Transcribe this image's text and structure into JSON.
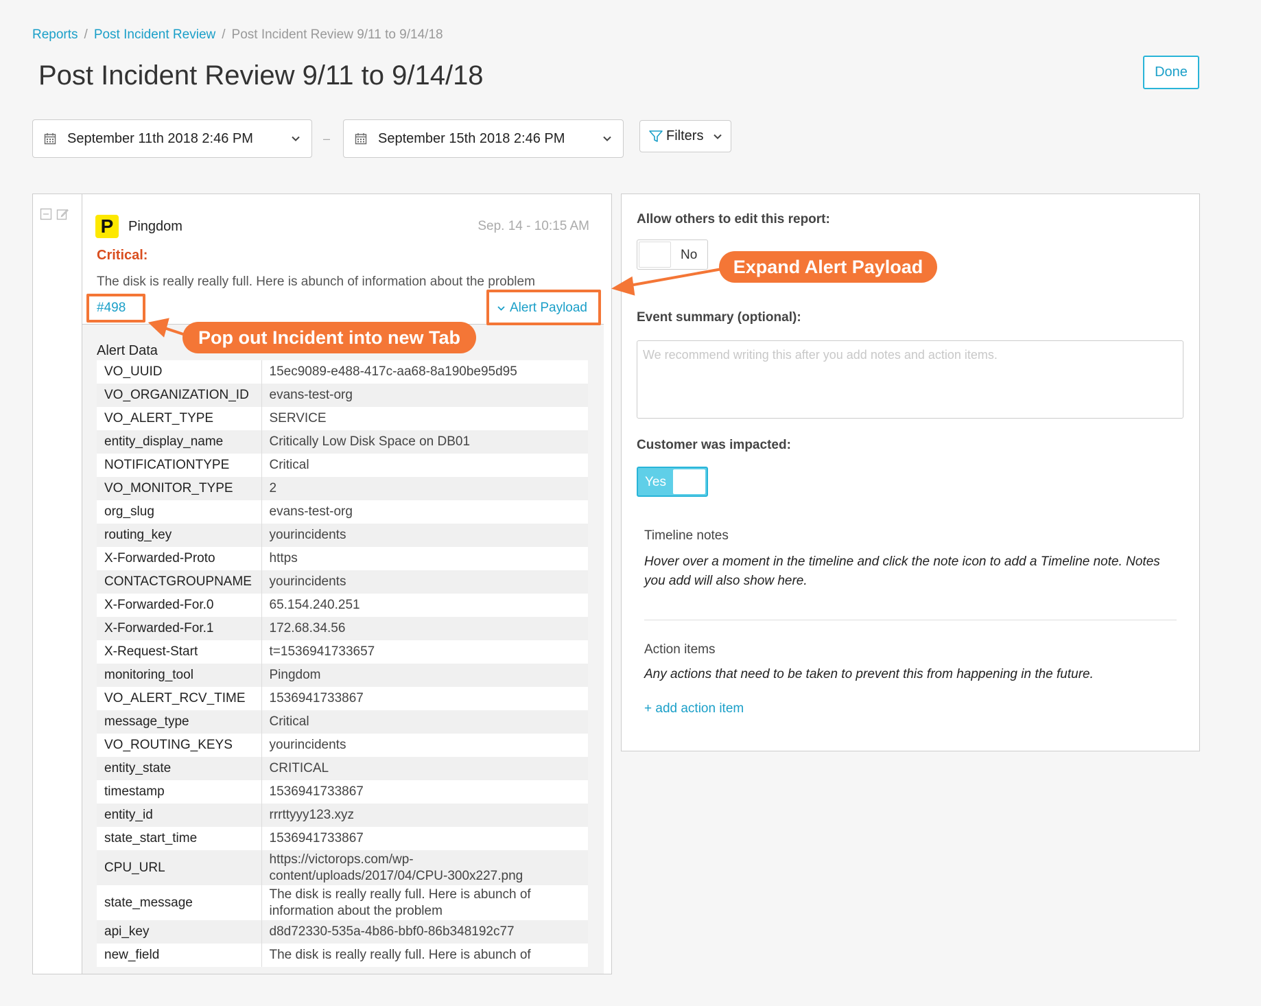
{
  "breadcrumb": {
    "items": [
      "Reports",
      "Post Incident Review"
    ],
    "current": "Post Incident Review 9/11 to 9/14/18",
    "separator": "/"
  },
  "header": {
    "title": "Post Incident Review 9/11 to 9/14/18",
    "done_label": "Done"
  },
  "filters": {
    "start_date": "September 11th 2018 2:46 PM",
    "end_date": "September 15th 2018 2:46 PM",
    "range_separator": "–",
    "filters_label": "Filters"
  },
  "incident": {
    "source": "Pingdom",
    "logo_letter": "P",
    "time": "Sep. 14 - 10:15 AM",
    "severity": "Critical:",
    "description": "The disk is really really full. Here is abunch of information about the problem",
    "link": "#498",
    "payload_toggle": "Alert Payload",
    "alert_data_heading": "Alert Data",
    "alert_data": [
      {
        "key": "VO_UUID",
        "value": "15ec9089-e488-417c-aa68-8a190be95d95"
      },
      {
        "key": "VO_ORGANIZATION_ID",
        "value": "evans-test-org"
      },
      {
        "key": "VO_ALERT_TYPE",
        "value": "SERVICE"
      },
      {
        "key": "entity_display_name",
        "value": "Critically Low Disk Space on DB01"
      },
      {
        "key": "NOTIFICATIONTYPE",
        "value": "Critical"
      },
      {
        "key": "VO_MONITOR_TYPE",
        "value": "2"
      },
      {
        "key": "org_slug",
        "value": "evans-test-org"
      },
      {
        "key": "routing_key",
        "value": "yourincidents"
      },
      {
        "key": "X-Forwarded-Proto",
        "value": "https"
      },
      {
        "key": "CONTACTGROUPNAME",
        "value": "yourincidents"
      },
      {
        "key": "X-Forwarded-For.0",
        "value": "65.154.240.251"
      },
      {
        "key": "X-Forwarded-For.1",
        "value": "172.68.34.56"
      },
      {
        "key": "X-Request-Start",
        "value": "t=1536941733657"
      },
      {
        "key": "monitoring_tool",
        "value": "Pingdom"
      },
      {
        "key": "VO_ALERT_RCV_TIME",
        "value": "1536941733867"
      },
      {
        "key": "message_type",
        "value": "Critical"
      },
      {
        "key": "VO_ROUTING_KEYS",
        "value": "yourincidents"
      },
      {
        "key": "entity_state",
        "value": "CRITICAL"
      },
      {
        "key": "timestamp",
        "value": "1536941733867"
      },
      {
        "key": "entity_id",
        "value": "rrrttyyy123.xyz"
      },
      {
        "key": "state_start_time",
        "value": "1536941733867"
      },
      {
        "key": "CPU_URL",
        "value": "https://victorops.com/wp-content/uploads/2017/04/CPU-300x227.png"
      },
      {
        "key": "state_message",
        "value": "The disk is really really full.  Here is abunch of information about the problem"
      },
      {
        "key": "api_key",
        "value": "d8d72330-535a-4b86-bbf0-86b348192c77"
      },
      {
        "key": "new_field",
        "value": "The disk is really really full.  Here is abunch of"
      }
    ]
  },
  "report": {
    "allow_edit_label": "Allow others to edit this report:",
    "allow_edit_value": "No",
    "summary_label": "Event summary (optional):",
    "summary_placeholder": "We recommend writing this after you add notes and action items.",
    "summary_value": "",
    "impacted_label": "Customer was impacted:",
    "impacted_value": "Yes",
    "timeline_heading": "Timeline notes",
    "timeline_hint": "Hover over a moment in the timeline and click the note icon to add a Timeline note. Notes you add will also show here.",
    "action_heading": "Action items",
    "action_hint": "Any actions that need to be taken to prevent this from happening in the future.",
    "add_action_label": "+ add action item"
  },
  "annotations": {
    "expand_payload": "Expand Alert Payload",
    "pop_out": "Pop out Incident into new Tab",
    "color": "#f47636"
  },
  "colors": {
    "accent": "#1a9fc8",
    "critical": "#d94e1f",
    "toggle_on": "#5fcfe8",
    "pingdom_yellow": "#fde800"
  }
}
